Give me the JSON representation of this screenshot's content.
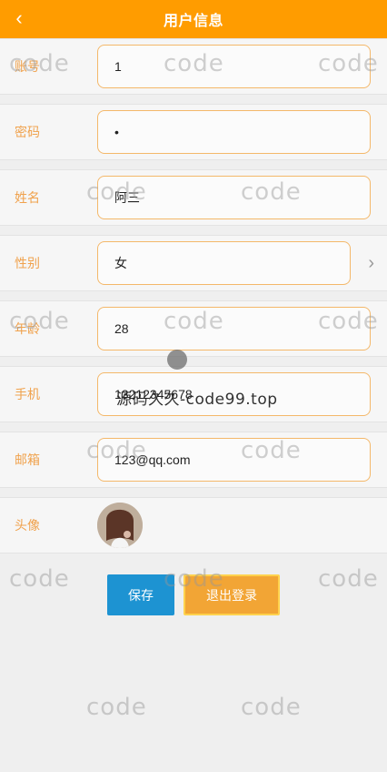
{
  "header": {
    "back_icon": "‹",
    "title": "用户信息"
  },
  "form": {
    "account": {
      "label": "账号",
      "value": "1"
    },
    "password": {
      "label": "密码",
      "value": "•"
    },
    "name": {
      "label": "姓名",
      "value": "阿三"
    },
    "gender": {
      "label": "性别",
      "value": "女",
      "chevron": "›"
    },
    "age": {
      "label": "年龄",
      "value": "28"
    },
    "phone": {
      "label": "手机",
      "value": "13212345678"
    },
    "email": {
      "label": "邮箱",
      "value": "123@qq.com"
    },
    "avatar": {
      "label": "头像"
    }
  },
  "buttons": {
    "save": "保存",
    "logout": "退出登录"
  },
  "watermark": {
    "text": "code",
    "overlay": "源码久久-code99.top"
  },
  "colors": {
    "header": "#ff9c00",
    "label": "#f0a24d",
    "save": "#1d93d2",
    "logout": "#f2a535"
  },
  "icons": {
    "back": "chevron-left-icon",
    "dropdown": "chevron-right-icon"
  }
}
